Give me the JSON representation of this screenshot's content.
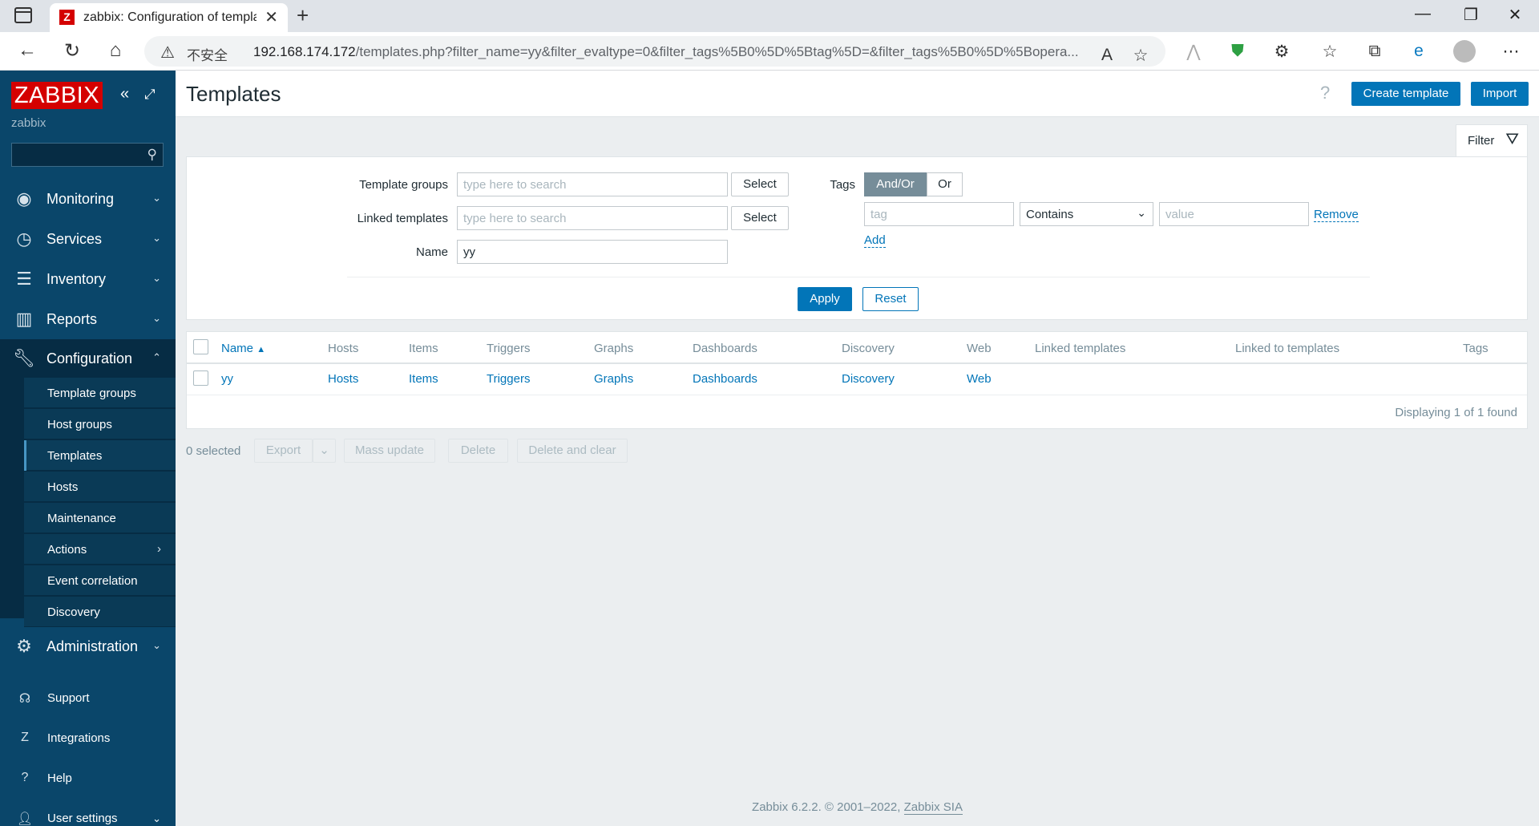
{
  "browser": {
    "tab_title": "zabbix: Configuration of templates",
    "favicon_letter": "Z",
    "insecure_label": "不安全",
    "url_host": "192.168.174.172",
    "url_path": "/templates.php?filter_name=yy&filter_evaltype=0&filter_tags%5B0%5D%5Btag%5D=&filter_tags%5B0%5D%5Bopera..."
  },
  "sidebar": {
    "logo": "ZABBIX",
    "server_name": "zabbix",
    "menu": [
      {
        "label": "Monitoring"
      },
      {
        "label": "Services"
      },
      {
        "label": "Inventory"
      },
      {
        "label": "Reports"
      },
      {
        "label": "Configuration"
      },
      {
        "label": "Administration"
      }
    ],
    "submenu": [
      {
        "label": "Template groups"
      },
      {
        "label": "Host groups"
      },
      {
        "label": "Templates"
      },
      {
        "label": "Hosts"
      },
      {
        "label": "Maintenance"
      },
      {
        "label": "Actions"
      },
      {
        "label": "Event correlation"
      },
      {
        "label": "Discovery"
      }
    ],
    "footer": [
      {
        "label": "Support"
      },
      {
        "label": "Integrations"
      },
      {
        "label": "Help"
      },
      {
        "label": "User settings"
      }
    ]
  },
  "header": {
    "title": "Templates",
    "help": "?",
    "create_label": "Create template",
    "import_label": "Import"
  },
  "filter": {
    "tab_label": "Filter",
    "template_groups_label": "Template groups",
    "linked_templates_label": "Linked templates",
    "name_label": "Name",
    "search_placeholder": "type here to search",
    "select_label": "Select",
    "name_value": "yy",
    "tags_label": "Tags",
    "andor_label": "And/Or",
    "or_label": "Or",
    "tag_placeholder": "tag",
    "operator_value": "Contains",
    "value_placeholder": "value",
    "remove_label": "Remove",
    "add_label": "Add",
    "apply_label": "Apply",
    "reset_label": "Reset"
  },
  "table": {
    "columns": [
      "Name",
      "Hosts",
      "Items",
      "Triggers",
      "Graphs",
      "Dashboards",
      "Discovery",
      "Web",
      "Linked templates",
      "Linked to templates",
      "Tags"
    ],
    "sort_indicator": "▲",
    "rows": [
      {
        "name": "yy",
        "hosts": "Hosts",
        "items": "Items",
        "triggers": "Triggers",
        "graphs": "Graphs",
        "dashboards": "Dashboards",
        "discovery": "Discovery",
        "web": "Web"
      }
    ],
    "display_info": "Displaying 1 of 1 found"
  },
  "actions": {
    "selected": "0 selected",
    "export_label": "Export",
    "mass_update_label": "Mass update",
    "delete_label": "Delete",
    "delete_clear_label": "Delete and clear"
  },
  "footer": {
    "version_text": "Zabbix 6.2.2. © 2001–2022,",
    "vendor_link": "Zabbix SIA"
  }
}
